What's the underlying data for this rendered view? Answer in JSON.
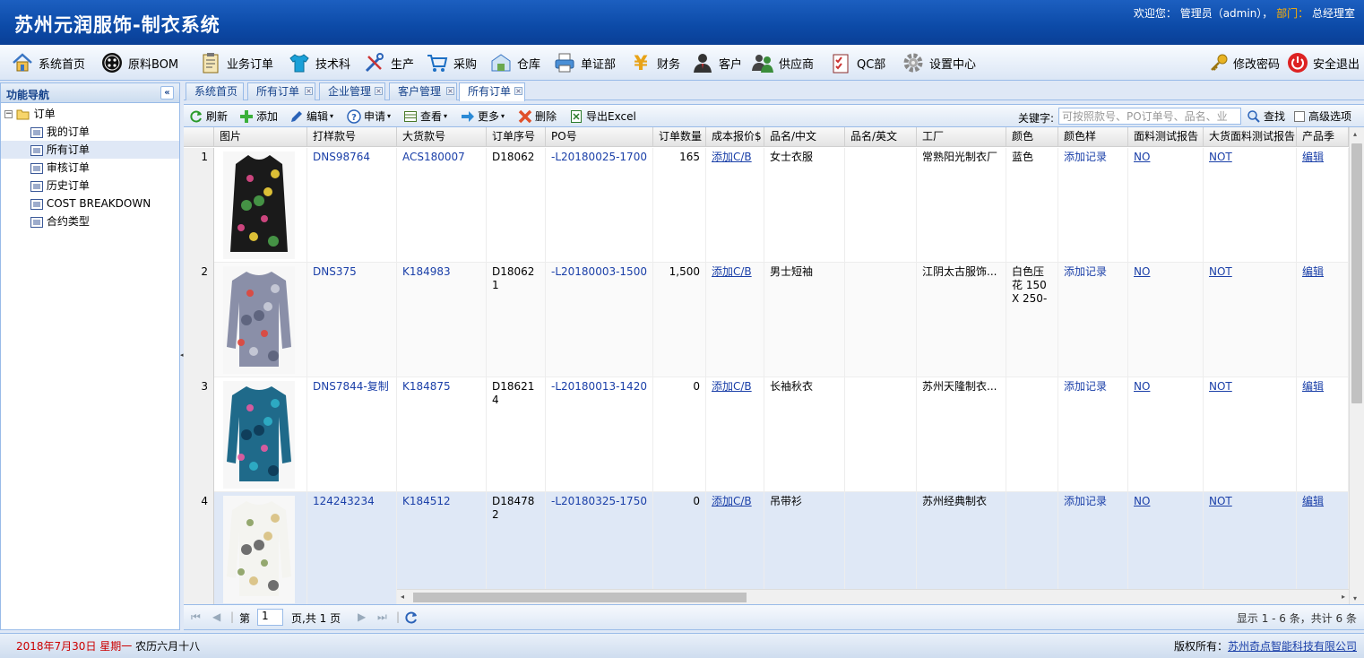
{
  "header": {
    "title": "苏州元润服饰-制衣系统",
    "welcome": "欢迎您：",
    "user": "管理员（admin），",
    "dept_label": "部门：",
    "dept": "总经理室"
  },
  "menu": {
    "items": [
      {
        "label": "系统首页",
        "icon": "home-icon"
      },
      {
        "label": "原料BOM",
        "icon": "button-icon"
      },
      {
        "label": "业务订单",
        "icon": "clipboard-icon"
      },
      {
        "label": "技术科",
        "icon": "shirt-icon"
      },
      {
        "label": "生产",
        "icon": "tools-icon"
      },
      {
        "label": "采购",
        "icon": "cart-icon"
      },
      {
        "label": "仓库",
        "icon": "warehouse-icon"
      },
      {
        "label": "单证部",
        "icon": "printer-icon"
      },
      {
        "label": "财务",
        "icon": "yen-icon"
      },
      {
        "label": "客户",
        "icon": "customer-icon"
      },
      {
        "label": "供应商",
        "icon": "supplier-icon"
      },
      {
        "label": "QC部",
        "icon": "checklist-icon"
      },
      {
        "label": "设置中心",
        "icon": "gear-icon"
      }
    ],
    "change_password": "修改密码",
    "logout": "安全退出"
  },
  "sidebar": {
    "title": "功能导航",
    "root": "订单",
    "items": [
      "我的订单",
      "所有订单",
      "审核订单",
      "历史订单",
      "COST BREAKDOWN",
      "合约类型"
    ]
  },
  "tabs": [
    {
      "label": "系统首页"
    },
    {
      "label": "所有订单"
    },
    {
      "label": "企业管理"
    },
    {
      "label": "客户管理"
    },
    {
      "label": "所有订单"
    }
  ],
  "toolbar": {
    "refresh": "刷新",
    "add": "添加",
    "edit": "编辑",
    "apply": "申请",
    "view": "查看",
    "more": "更多",
    "delete": "删除",
    "export": "导出Excel",
    "keyword_label": "关键字:",
    "keyword_placeholder": "可按照款号、PO订单号、品名、业务员",
    "search": "查找",
    "advanced": "高级选项"
  },
  "grid": {
    "columns": [
      "图片",
      "打样款号",
      "大货款号",
      "订单序号",
      "PO号",
      "订单数量",
      "成本报价$",
      "品名/中文",
      "品名/英文",
      "工厂",
      "颜色",
      "颜色样",
      "面料测试报告",
      "大货面料测试报告",
      "产品季"
    ],
    "rows": [
      {
        "n": "1",
        "sample": "DNS98764",
        "bulk": "ACS180007",
        "seq": "D18062",
        "po": "-L20180025-1700",
        "qty": "165",
        "cost": "添加C/B",
        "cn": "女士衣服",
        "en": "",
        "factory": "常熟阳光制衣厂",
        "color": "蓝色",
        "swatch": "添加记录",
        "fabric": "NO",
        "bulkfabric": "NOT",
        "season": "编辑"
      },
      {
        "n": "2",
        "sample": "DNS375",
        "bulk": "K184983",
        "seq": "D180621",
        "po": "-L20180003-1500",
        "qty": "1,500",
        "cost": "添加C/B",
        "cn": "男士短袖",
        "en": "",
        "factory": "江阴太古服饰...",
        "color": "白色压花 150X 250-",
        "swatch": "添加记录",
        "fabric": "NO",
        "bulkfabric": "NOT",
        "season": "编辑"
      },
      {
        "n": "3",
        "sample": "DNS7844-复制",
        "bulk": "K184875",
        "seq": "D186214",
        "po": "-L20180013-1420",
        "qty": "0",
        "cost": "添加C/B",
        "cn": "长袖秋衣",
        "en": "",
        "factory": "苏州天隆制衣...",
        "color": "",
        "swatch": "添加记录",
        "fabric": "NO",
        "bulkfabric": "NOT",
        "season": "编辑"
      },
      {
        "n": "4",
        "sample": "124243234",
        "bulk": "K184512",
        "seq": "D184782",
        "po": "-L20180325-1750",
        "qty": "0",
        "cost": "添加C/B",
        "cn": "吊带衫",
        "en": "",
        "factory": "苏州经典制衣",
        "color": "",
        "swatch": "添加记录",
        "fabric": "NO",
        "bulkfabric": "NOT",
        "season": "编辑"
      }
    ]
  },
  "pager": {
    "page_label": "第",
    "page": "1",
    "of_pages": "页,共 1 页",
    "summary": "显示 1 - 6 条，共计 6 条"
  },
  "footer": {
    "date": "2018年7月30日 星期一",
    "lunar": "农历六月十八",
    "copyright_label": "版权所有：",
    "company": "苏州奇点智能科技有限公司"
  },
  "colors": {
    "header_bg": "#0c4aa7",
    "border": "#99bbe8",
    "link": "#1a3fa8",
    "dept": "#ffb000",
    "date": "#cc0000"
  }
}
